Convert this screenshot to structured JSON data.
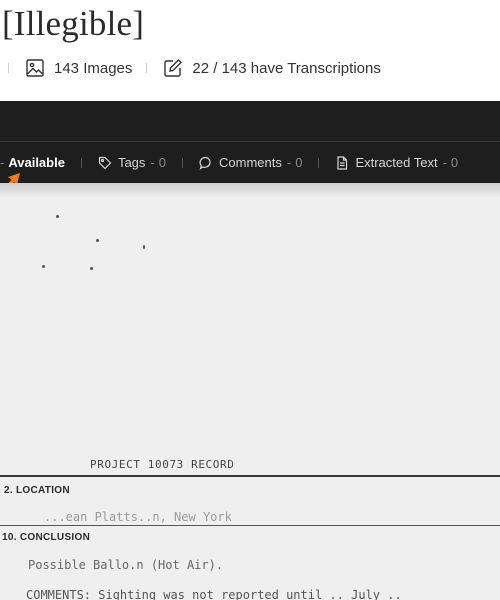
{
  "header": {
    "title": "[Illegible]",
    "images_label": "143 Images",
    "transcriptions_label": "22 / 143 have Transcriptions"
  },
  "toolbar": {
    "available_label": "Available",
    "tags_label": "Tags",
    "tags_count": "0",
    "comments_label": "Comments",
    "comments_count": "0",
    "extracted_text_label": "Extracted Text",
    "extracted_text_count": "0"
  },
  "document": {
    "project_line": "PROJECT 10073 RECORD",
    "location_label": "2. LOCATION",
    "location_value": "...ean Platts..n, New York",
    "conclusion_label": "10. CONCLUSION",
    "conclusion_value": "Possible Ballo.n (Hot Air).",
    "comments_value": "COMMENTS:  Sighting was not reported until .. July .."
  },
  "colors": {
    "accent_arrow": "#f07d1a",
    "viewer_bg": "#1e1e1e",
    "paper": "#efefef"
  },
  "icons": [
    "images-icon",
    "edit-icon",
    "tag-icon",
    "comment-icon",
    "document-icon",
    "pointer-arrow-icon"
  ]
}
